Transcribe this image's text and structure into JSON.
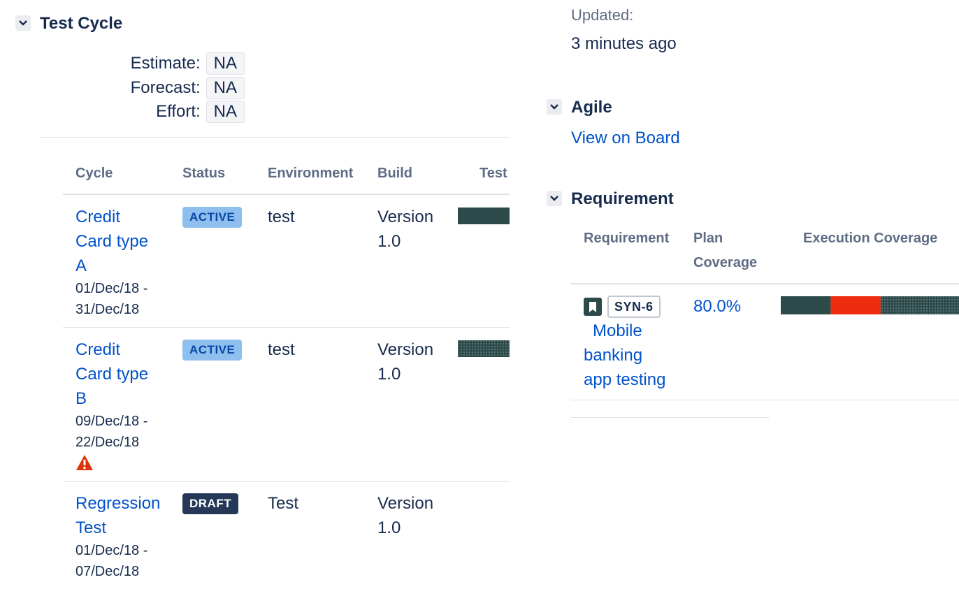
{
  "test_cycle": {
    "title": "Test Cycle",
    "estimate_label": "Estimate:",
    "estimate_value": "NA",
    "forecast_label": "Forecast:",
    "forecast_value": "NA",
    "effort_label": "Effort:",
    "effort_value": "NA",
    "columns": {
      "cycle": "Cycle",
      "status": "Status",
      "environment": "Environment",
      "build": "Build",
      "test": "Test"
    },
    "rows": [
      {
        "name_line1": "Credit",
        "name_line2": "Card type",
        "name_line3": "A",
        "dates_line1": "01/Dec/18 -",
        "dates_line2": "31/Dec/18",
        "status": "ACTIVE",
        "environment": "test",
        "build_line1": "Version",
        "build_line2": "1.0",
        "progress": {
          "color": "#2c4a4a",
          "pattern": "solid"
        }
      },
      {
        "name_line1": "Credit",
        "name_line2": "Card type",
        "name_line3": "B",
        "dates_line1": "09/Dec/18 -",
        "dates_line2": "22/Dec/18",
        "warning_icon": "warning-icon",
        "status": "ACTIVE",
        "environment": "test",
        "build_line1": "Version",
        "build_line2": "1.0",
        "progress": {
          "color": "#2c4a4a",
          "pattern": "dotted"
        }
      },
      {
        "name_line1": "Regression",
        "name_line2": "Test",
        "dates_line1": "01/Dec/18 -",
        "dates_line2": "07/Dec/18",
        "status": "DRAFT",
        "environment": "Test",
        "build_line1": "Version",
        "build_line2": "1.0"
      }
    ]
  },
  "updated": {
    "label": "Updated:",
    "value": "3 minutes ago"
  },
  "agile": {
    "title": "Agile",
    "link": "View on Board"
  },
  "requirement": {
    "title": "Requirement",
    "columns": {
      "requirement": "Requirement",
      "plan_line1": "Plan",
      "plan_line2": "Coverage",
      "execution": "Execution Coverage"
    },
    "rows": [
      {
        "key": "SYN-6",
        "icon": "bookmark-icon",
        "title_line1": "Mobile",
        "title_line2": "banking",
        "title_line3": "app testing",
        "plan_coverage": "80.0%",
        "execution_segments": [
          {
            "color": "#2c4a4a",
            "fraction": 0.28,
            "pattern": "solid"
          },
          {
            "color": "#ef2b10",
            "fraction": 0.28,
            "pattern": "solid"
          },
          {
            "color": "#2c4a4a",
            "fraction": 0.44,
            "pattern": "dotted"
          }
        ]
      }
    ]
  },
  "colors": {
    "link": "#0052cc",
    "text": "#172b4d",
    "muted": "#5e6c84",
    "active_lozenge": "#8fbfee",
    "draft_lozenge": "#253858",
    "pass": "#2c4a4a",
    "fail": "#ef2b10",
    "warning": "#de350b"
  }
}
